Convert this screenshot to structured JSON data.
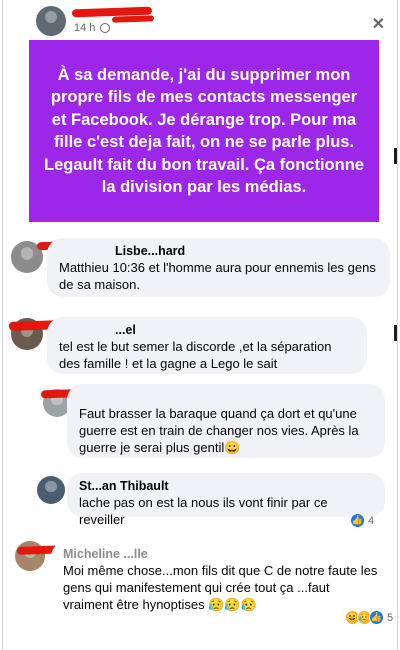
{
  "post": {
    "time": "14 h",
    "banner_text": "À sa demande, j'ai du supprimer mon propre fils de mes contacts messenger et Facebook. Je dérange trop. Pour ma fille c'est deja fait, on ne se parle plus. Legault fait du bon travail. Ça fonctionne la division par les médias.",
    "banner_color": "#9d27e8"
  },
  "comments": [
    {
      "author_visible": "Lisbe...hard",
      "text": "Matthieu 10:36 et l'homme aura pour ennemis les gens de sa maison."
    },
    {
      "author_visible": "...el",
      "text": "tel est le but semer la discorde ,et la séparation des famille ! et la gagne a Lego le sait"
    },
    {
      "author_visible": "",
      "text": "Faut brasser la baraque quand ça dort et qu'une guerre est en train de changer nos vies. Après la guerre je serai plus gentil😀"
    },
    {
      "author_visible": "St...an Thibault",
      "text": "lache pas on est la nous ils vont finir par ce reveiller",
      "reaction_count": "4"
    },
    {
      "author_visible": "Micheline ...lle",
      "text": "Moi même chose...mon fils dit que C de notre faute les gens qui manifestement qui crée tout ça ...faut vraiment être hynoptises 😥😥😥",
      "reaction_count": "5"
    }
  ],
  "icons": {
    "globe": "globe-icon",
    "close": "close-icon",
    "like": "like-reaction-icon",
    "haha": "haha-reaction-icon",
    "sad": "sad-reaction-icon"
  },
  "colors": {
    "accent_purple": "#9d27e8",
    "redaction_red": "#e4170f",
    "bubble_gray": "#f0f2f5",
    "like_blue": "#1877f2"
  }
}
